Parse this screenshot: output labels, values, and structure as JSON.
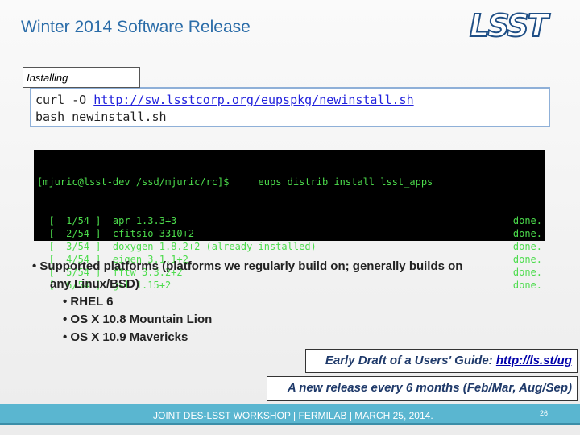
{
  "title": "Winter 2014 Software Release",
  "logo": "LSST",
  "installing_label": "Installing",
  "cmd": {
    "line1_prefix": "curl -O ",
    "line1_url": "http://sw.lsstcorp.org/eupspkg/newinstall.sh",
    "line2": "bash newinstall.sh"
  },
  "terminal": {
    "prompt": "[mjuric@lsst-dev /ssd/mjuric/rc]$     eups distrib install lsst_apps",
    "rows": [
      {
        "text": "  [  1/54 ]  apr 1.3.3+3",
        "status": "done."
      },
      {
        "text": "  [  2/54 ]  cfitsio 3310+2",
        "status": "done."
      },
      {
        "text": "  [  3/54 ]  doxygen 1.8.2+2 (already installed)",
        "status": "done."
      },
      {
        "text": "  [  4/54 ]  eigen 3.1.1+2",
        "status": "done."
      },
      {
        "text": "  [  5/54 ]  fftw 3.3.2+2",
        "status": "done."
      },
      {
        "text": "  [  6/54 ]  gsl 1.15+2",
        "status": "done."
      }
    ]
  },
  "bullets": {
    "main1": "•  Supported platforms (platforms we regularly build on; generally builds on",
    "main2": "any Linux/BSD)",
    "subs": [
      "•   RHEL 6",
      "•   OS X 10.8 Mountain Lion",
      "•   OS X 10.9 Mavericks"
    ]
  },
  "guide": {
    "text": "Early Draft of a Users' Guide: ",
    "url": "http://ls.st/ug"
  },
  "release": "A new release every 6 months (Feb/Mar, Aug/Sep)",
  "footer": {
    "text": "JOINT DES-LSST WORKSHOP | FERMILAB | MARCH 25, 2014.",
    "page": "26"
  }
}
